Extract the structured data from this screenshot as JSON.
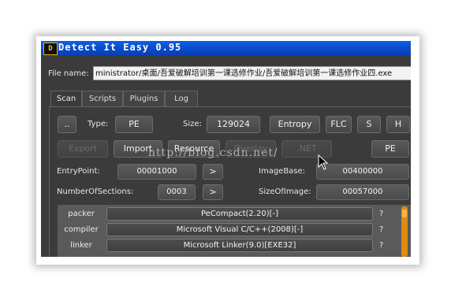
{
  "window": {
    "title": "Detect It Easy 0.95",
    "icon_text": "D"
  },
  "file": {
    "label": "File name:",
    "value": "ministrator/桌面/吾爱破解培训第一课选修作业/吾爱破解培训第一课选修作业四.exe"
  },
  "tabs": [
    {
      "label": "Scan",
      "active": true
    },
    {
      "label": "Scripts"
    },
    {
      "label": "Plugins"
    },
    {
      "label": "Log"
    }
  ],
  "toolbar": {
    "up_label": "..",
    "type_label": "Type:",
    "type_value": "PE",
    "size_label": "Size:",
    "size_value": "129024",
    "entropy_label": "Entropy",
    "flc_label": "FLC",
    "s_label": "S",
    "h_label": "H"
  },
  "actions": {
    "export_label": "Export",
    "import_label": "Import",
    "resource_label": "Resource",
    "overlay_label": "Overlay",
    "net_label": ".NET",
    "pe_label": "PE"
  },
  "info": {
    "entrypoint_label": "EntryPoint:",
    "entrypoint_value": "00001000",
    "imagebase_label": "ImageBase:",
    "imagebase_value": "00400000",
    "sections_label": "NumberOfSections:",
    "sections_value": "0003",
    "sizeofimage_label": "SizeOfImage:",
    "sizeofimage_value": "00057000",
    "arrow": ">"
  },
  "watermark": "http://blog.csdn.net/",
  "detections": [
    {
      "type": "packer",
      "value": "PeCompact(2.20)[-]",
      "help": "?"
    },
    {
      "type": "compiler",
      "value": "Microsoft Visual C/C++(2008)[-]",
      "help": "?"
    },
    {
      "type": "linker",
      "value": "Microsoft Linker(9.0)[EXE32]",
      "help": "?"
    }
  ],
  "colors": {
    "titlebar": "#0a49c8",
    "window_bg": "#3b3b3b",
    "scrollbar": "#e08a10"
  }
}
